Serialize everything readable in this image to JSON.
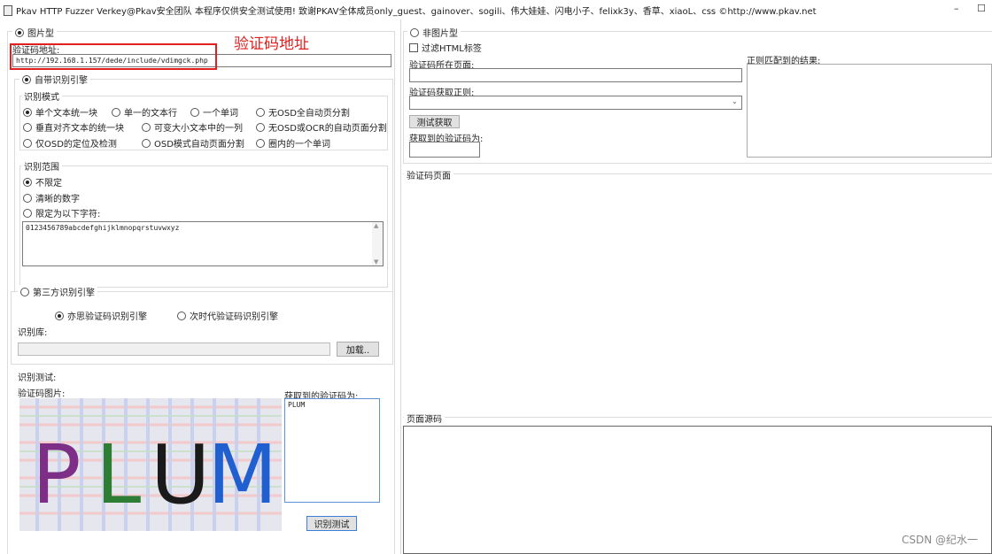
{
  "window": {
    "title": "Pkav HTTP Fuzzer   Verkey@Pkav安全团队  本程序仅供安全测试使用!  致谢PKAV全体成员only_guest、gainover、sogili、伟大娃娃、闪电小子、felixk3y、香草、xiaoL、css  ©http://www.pkav.net",
    "minimize_glyph": "–",
    "maximize_glyph": "☐"
  },
  "left": {
    "image_type_label": "图片型",
    "captcha_url_label": "验证码地址:",
    "captcha_url_value": "http://192.168.1.157/dede/include/vdimgck.php",
    "annotation": "验证码地址",
    "builtin_engine_label": "自带识别引擎",
    "mode": {
      "title": "识别模式",
      "options": [
        "单个文本统一块",
        "单一的文本行",
        "一个单词",
        "无OSD全自动页分割",
        "垂直对齐文本的统一块",
        "可变大小文本中的一列",
        "无OSD或OCR的自动页面分割",
        "仅OSD的定位及检测",
        "OSD模式自动页面分割",
        "圈内的一个单词"
      ]
    },
    "range": {
      "title": "识别范围",
      "options": [
        "不限定",
        "清晰的数字",
        "限定为以下字符:"
      ],
      "charset": "0123456789abcdefghijklmnopqrstuvwxyz"
    },
    "third_party": {
      "label": "第三方识别引擎",
      "engine_a": "亦思验证码识别引擎",
      "engine_b": "次时代验证码识别引擎",
      "library_label": "识别库:",
      "load_button": "加载.."
    },
    "test": {
      "label": "识别测试:",
      "image_label": "验证码图片:",
      "result_label": "获取到的验证码为:",
      "result_value": "PLUM",
      "test_button": "识别测试",
      "captcha_letters": [
        "P",
        "L",
        "U",
        "M"
      ],
      "captcha_colors": [
        "#7d2e86",
        "#2e7d35",
        "#1a1a1a",
        "#1f5fd0"
      ]
    }
  },
  "right": {
    "non_image_label": "非图片型",
    "filter_html_label": "过滤HTML标签",
    "page_label": "验证码所在页面:",
    "regex_label": "验证码获取正则:",
    "test_fetch_button": "测试获取",
    "fetched_label": "获取到的验证码为:",
    "regex_result_label": "正则匹配到的结果:",
    "captcha_page_label": "验证码页面",
    "page_source_label": "页面源码"
  },
  "watermark": "CSDN @纪水一",
  "colors": {
    "annotation_red": "#e02020"
  }
}
